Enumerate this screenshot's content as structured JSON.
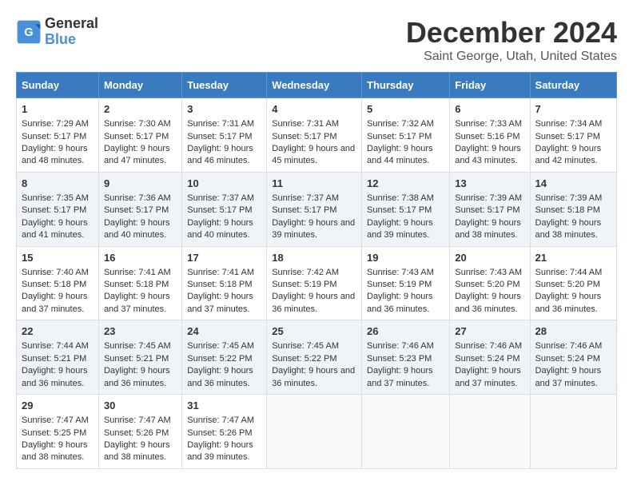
{
  "logo": {
    "line1": "General",
    "line2": "Blue"
  },
  "title": "December 2024",
  "subtitle": "Saint George, Utah, United States",
  "days_of_week": [
    "Sunday",
    "Monday",
    "Tuesday",
    "Wednesday",
    "Thursday",
    "Friday",
    "Saturday"
  ],
  "weeks": [
    [
      {
        "day": "1",
        "sunrise": "Sunrise: 7:29 AM",
        "sunset": "Sunset: 5:17 PM",
        "daylight": "Daylight: 9 hours and 48 minutes."
      },
      {
        "day": "2",
        "sunrise": "Sunrise: 7:30 AM",
        "sunset": "Sunset: 5:17 PM",
        "daylight": "Daylight: 9 hours and 47 minutes."
      },
      {
        "day": "3",
        "sunrise": "Sunrise: 7:31 AM",
        "sunset": "Sunset: 5:17 PM",
        "daylight": "Daylight: 9 hours and 46 minutes."
      },
      {
        "day": "4",
        "sunrise": "Sunrise: 7:31 AM",
        "sunset": "Sunset: 5:17 PM",
        "daylight": "Daylight: 9 hours and 45 minutes."
      },
      {
        "day": "5",
        "sunrise": "Sunrise: 7:32 AM",
        "sunset": "Sunset: 5:17 PM",
        "daylight": "Daylight: 9 hours and 44 minutes."
      },
      {
        "day": "6",
        "sunrise": "Sunrise: 7:33 AM",
        "sunset": "Sunset: 5:16 PM",
        "daylight": "Daylight: 9 hours and 43 minutes."
      },
      {
        "day": "7",
        "sunrise": "Sunrise: 7:34 AM",
        "sunset": "Sunset: 5:17 PM",
        "daylight": "Daylight: 9 hours and 42 minutes."
      }
    ],
    [
      {
        "day": "8",
        "sunrise": "Sunrise: 7:35 AM",
        "sunset": "Sunset: 5:17 PM",
        "daylight": "Daylight: 9 hours and 41 minutes."
      },
      {
        "day": "9",
        "sunrise": "Sunrise: 7:36 AM",
        "sunset": "Sunset: 5:17 PM",
        "daylight": "Daylight: 9 hours and 40 minutes."
      },
      {
        "day": "10",
        "sunrise": "Sunrise: 7:37 AM",
        "sunset": "Sunset: 5:17 PM",
        "daylight": "Daylight: 9 hours and 40 minutes."
      },
      {
        "day": "11",
        "sunrise": "Sunrise: 7:37 AM",
        "sunset": "Sunset: 5:17 PM",
        "daylight": "Daylight: 9 hours and 39 minutes."
      },
      {
        "day": "12",
        "sunrise": "Sunrise: 7:38 AM",
        "sunset": "Sunset: 5:17 PM",
        "daylight": "Daylight: 9 hours and 39 minutes."
      },
      {
        "day": "13",
        "sunrise": "Sunrise: 7:39 AM",
        "sunset": "Sunset: 5:17 PM",
        "daylight": "Daylight: 9 hours and 38 minutes."
      },
      {
        "day": "14",
        "sunrise": "Sunrise: 7:39 AM",
        "sunset": "Sunset: 5:18 PM",
        "daylight": "Daylight: 9 hours and 38 minutes."
      }
    ],
    [
      {
        "day": "15",
        "sunrise": "Sunrise: 7:40 AM",
        "sunset": "Sunset: 5:18 PM",
        "daylight": "Daylight: 9 hours and 37 minutes."
      },
      {
        "day": "16",
        "sunrise": "Sunrise: 7:41 AM",
        "sunset": "Sunset: 5:18 PM",
        "daylight": "Daylight: 9 hours and 37 minutes."
      },
      {
        "day": "17",
        "sunrise": "Sunrise: 7:41 AM",
        "sunset": "Sunset: 5:18 PM",
        "daylight": "Daylight: 9 hours and 37 minutes."
      },
      {
        "day": "18",
        "sunrise": "Sunrise: 7:42 AM",
        "sunset": "Sunset: 5:19 PM",
        "daylight": "Daylight: 9 hours and 36 minutes."
      },
      {
        "day": "19",
        "sunrise": "Sunrise: 7:43 AM",
        "sunset": "Sunset: 5:19 PM",
        "daylight": "Daylight: 9 hours and 36 minutes."
      },
      {
        "day": "20",
        "sunrise": "Sunrise: 7:43 AM",
        "sunset": "Sunset: 5:20 PM",
        "daylight": "Daylight: 9 hours and 36 minutes."
      },
      {
        "day": "21",
        "sunrise": "Sunrise: 7:44 AM",
        "sunset": "Sunset: 5:20 PM",
        "daylight": "Daylight: 9 hours and 36 minutes."
      }
    ],
    [
      {
        "day": "22",
        "sunrise": "Sunrise: 7:44 AM",
        "sunset": "Sunset: 5:21 PM",
        "daylight": "Daylight: 9 hours and 36 minutes."
      },
      {
        "day": "23",
        "sunrise": "Sunrise: 7:45 AM",
        "sunset": "Sunset: 5:21 PM",
        "daylight": "Daylight: 9 hours and 36 minutes."
      },
      {
        "day": "24",
        "sunrise": "Sunrise: 7:45 AM",
        "sunset": "Sunset: 5:22 PM",
        "daylight": "Daylight: 9 hours and 36 minutes."
      },
      {
        "day": "25",
        "sunrise": "Sunrise: 7:45 AM",
        "sunset": "Sunset: 5:22 PM",
        "daylight": "Daylight: 9 hours and 36 minutes."
      },
      {
        "day": "26",
        "sunrise": "Sunrise: 7:46 AM",
        "sunset": "Sunset: 5:23 PM",
        "daylight": "Daylight: 9 hours and 37 minutes."
      },
      {
        "day": "27",
        "sunrise": "Sunrise: 7:46 AM",
        "sunset": "Sunset: 5:24 PM",
        "daylight": "Daylight: 9 hours and 37 minutes."
      },
      {
        "day": "28",
        "sunrise": "Sunrise: 7:46 AM",
        "sunset": "Sunset: 5:24 PM",
        "daylight": "Daylight: 9 hours and 37 minutes."
      }
    ],
    [
      {
        "day": "29",
        "sunrise": "Sunrise: 7:47 AM",
        "sunset": "Sunset: 5:25 PM",
        "daylight": "Daylight: 9 hours and 38 minutes."
      },
      {
        "day": "30",
        "sunrise": "Sunrise: 7:47 AM",
        "sunset": "Sunset: 5:26 PM",
        "daylight": "Daylight: 9 hours and 38 minutes."
      },
      {
        "day": "31",
        "sunrise": "Sunrise: 7:47 AM",
        "sunset": "Sunset: 5:26 PM",
        "daylight": "Daylight: 9 hours and 39 minutes."
      },
      null,
      null,
      null,
      null
    ]
  ]
}
